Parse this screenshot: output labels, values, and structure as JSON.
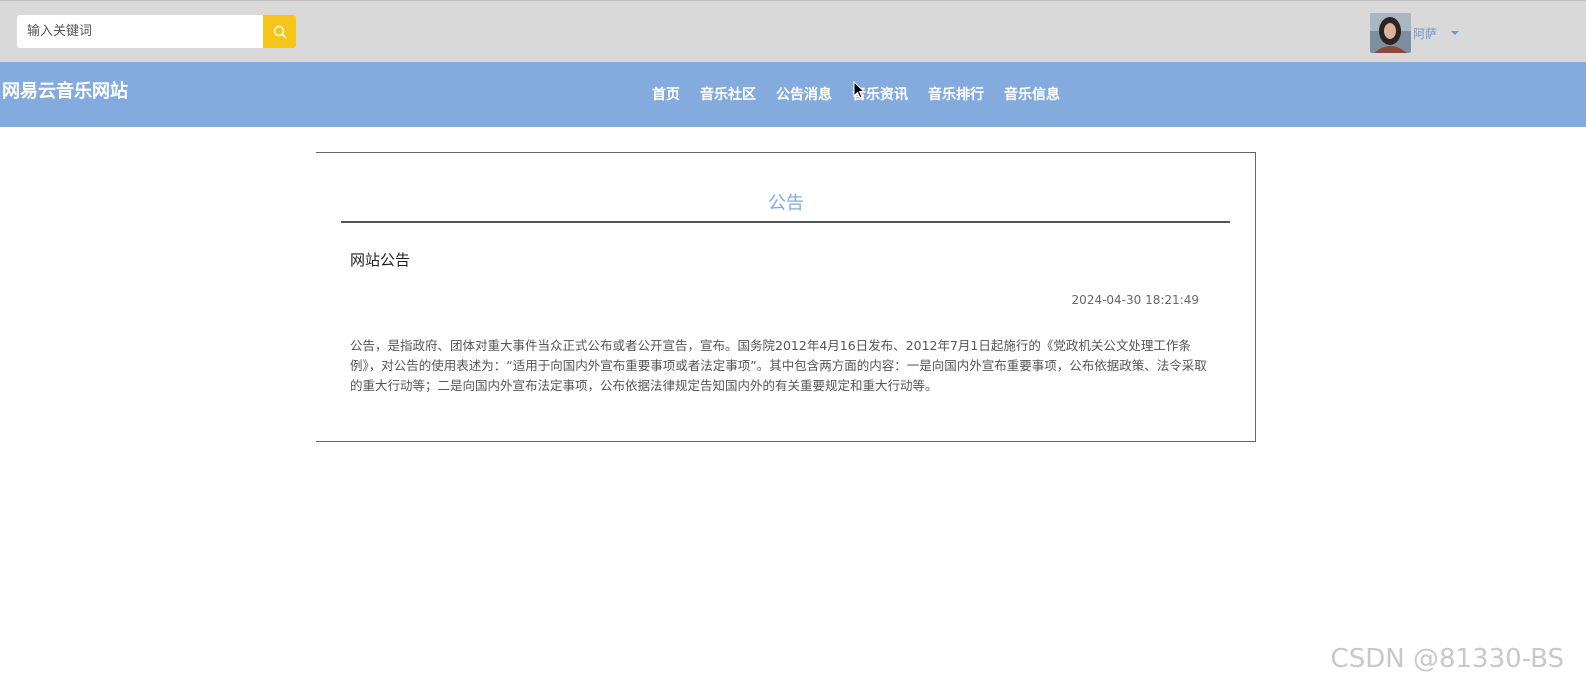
{
  "search": {
    "placeholder": "输入关键词",
    "button_icon": "search-icon",
    "button_color": "#f5c518"
  },
  "user": {
    "name": "阿萨",
    "avatar_icon": "avatar"
  },
  "brand": {
    "title": "网易云音乐网站"
  },
  "nav": {
    "items": [
      {
        "label": "首页"
      },
      {
        "label": "音乐社区"
      },
      {
        "label": "公告消息"
      },
      {
        "label": "音乐资讯"
      },
      {
        "label": "音乐排行"
      },
      {
        "label": "音乐信息"
      }
    ]
  },
  "notice": {
    "heading": "公告",
    "title": "网站公告",
    "date": "2024-04-30 18:21:49",
    "body": "公告，是指政府、团体对重大事件当众正式公布或者公开宣告，宣布。国务院2012年4月16日发布、2012年7月1日起施行的《党政机关公文处理工作条例》，对公告的使用表述为：“适用于向国内外宣布重要事项或者法定事项”。其中包含两方面的内容：一是向国内外宣布重要事项，公布依据政策、法令采取的重大行动等；二是向国内外宣布法定事项，公布依据法律规定告知国内外的有关重要规定和重大行动等。"
  },
  "watermark": "CSDN @81330-BS",
  "colors": {
    "nav_bg": "#84abdd",
    "topbar_bg": "#d9d9d9",
    "accent": "#84abdd"
  }
}
